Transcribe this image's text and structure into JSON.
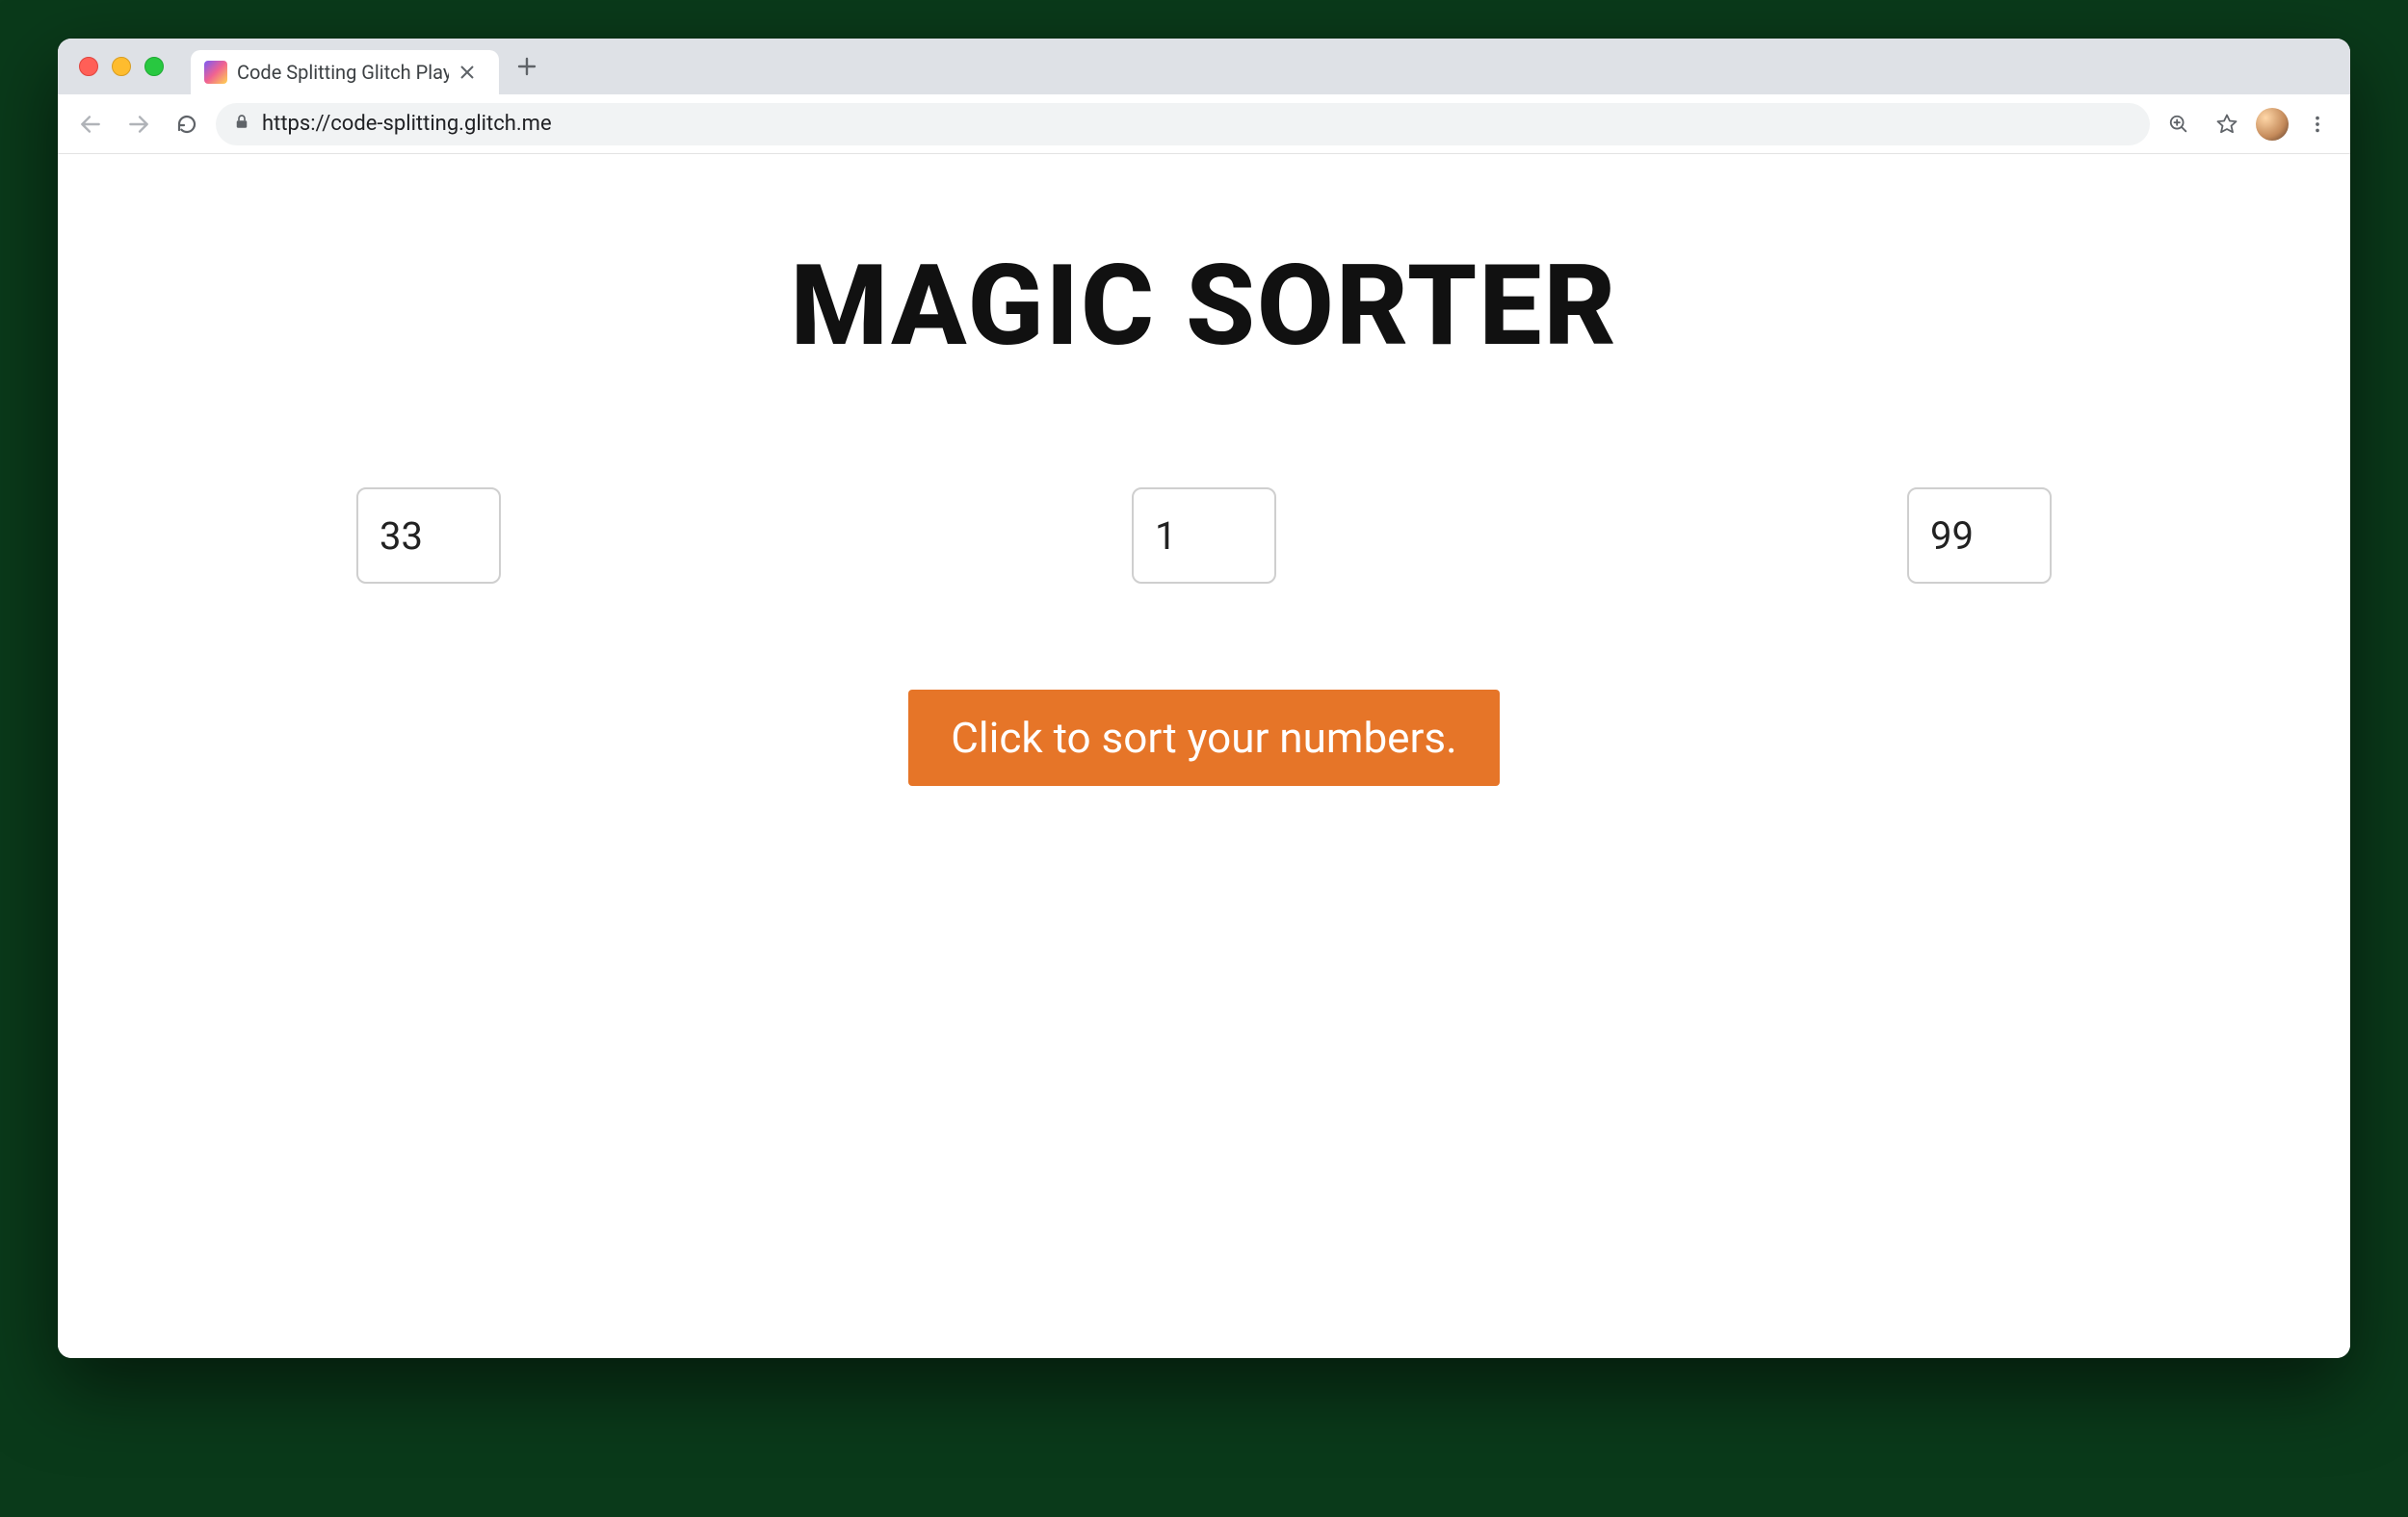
{
  "browser": {
    "tab": {
      "title": "Code Splitting Glitch Playgroun"
    },
    "url": "https://code-splitting.glitch.me"
  },
  "page": {
    "heading": "MAGIC SORTER",
    "inputs": {
      "a": "33",
      "b": "1",
      "c": "99"
    },
    "button_label": "Click to sort your numbers."
  },
  "colors": {
    "accent": "#e67528"
  }
}
